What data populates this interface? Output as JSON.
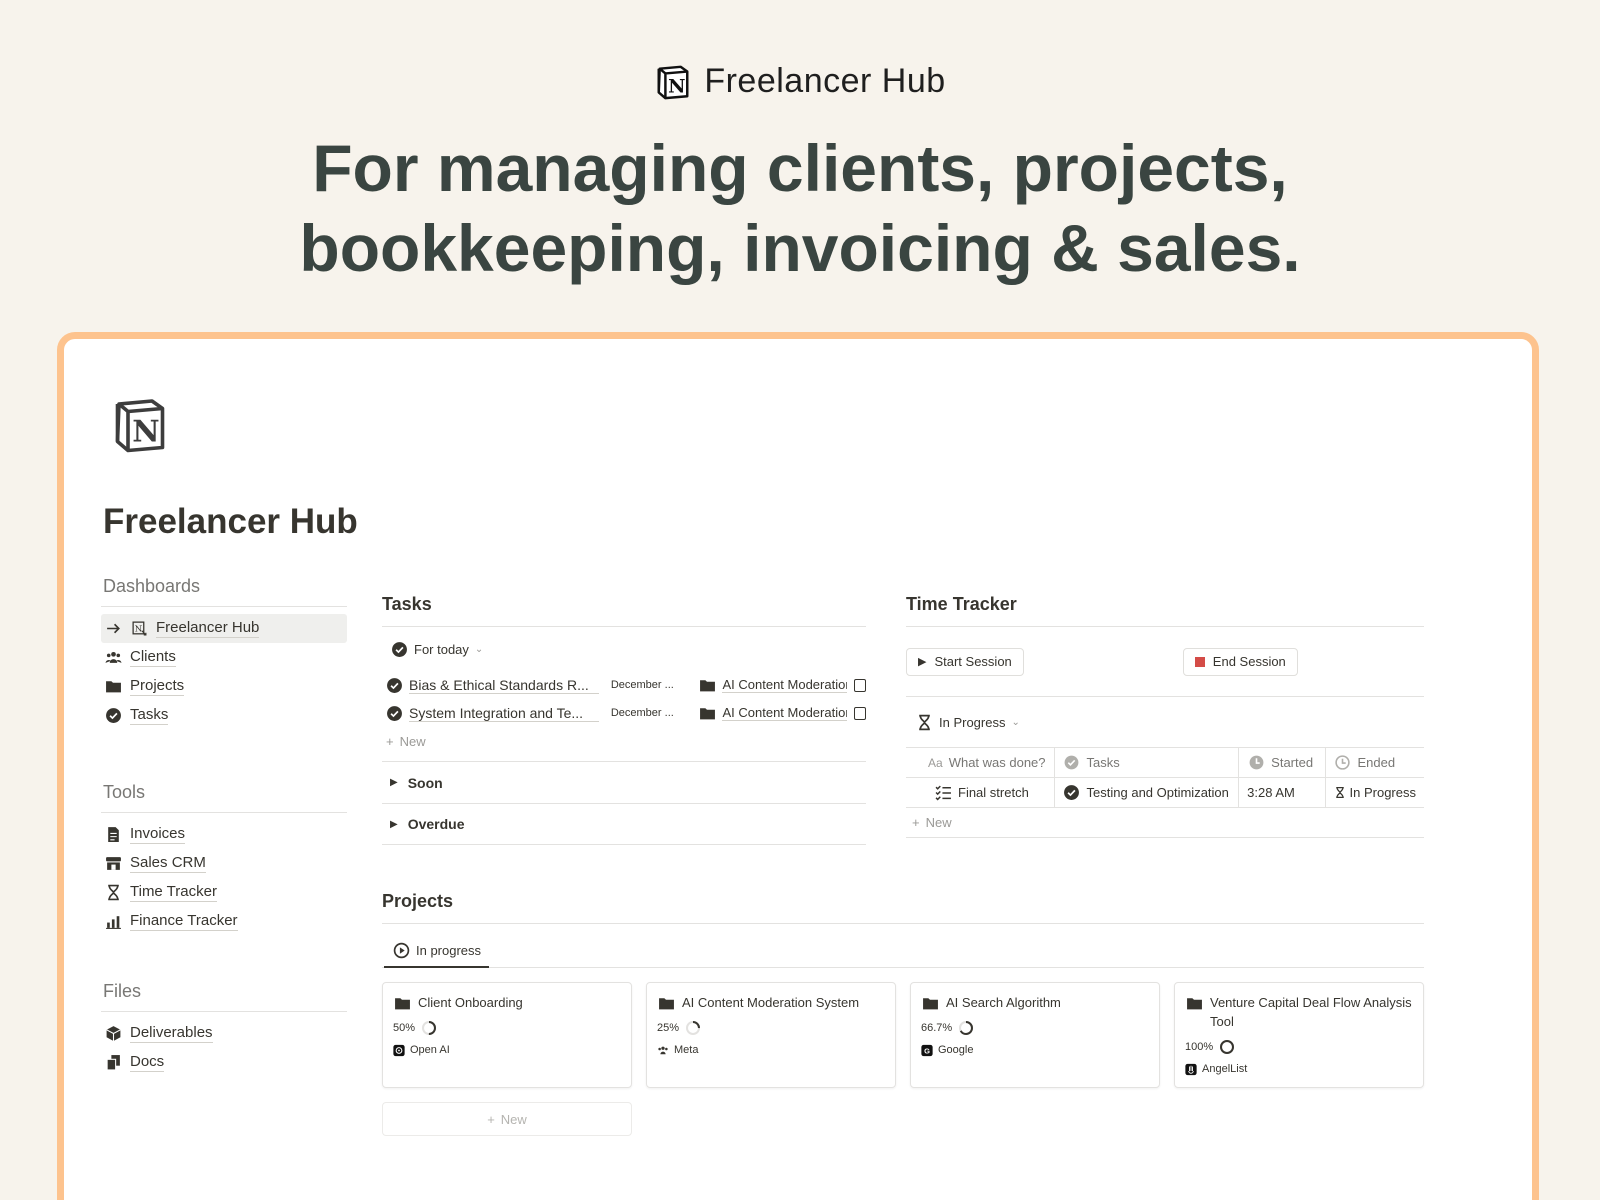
{
  "hero": {
    "brand_name": "Freelancer Hub",
    "headline_line1": "For managing clients, projects,",
    "headline_line2": "bookkeeping, invoicing & sales."
  },
  "page": {
    "title": "Freelancer Hub"
  },
  "sidebar": {
    "dashboards": {
      "heading": "Dashboards",
      "items": [
        {
          "label": "Freelancer Hub",
          "icon": "notion-link-icon",
          "active": true
        },
        {
          "label": "Clients",
          "icon": "people-icon"
        },
        {
          "label": "Projects",
          "icon": "folder-icon"
        },
        {
          "label": "Tasks",
          "icon": "check-circle-icon"
        }
      ]
    },
    "tools": {
      "heading": "Tools",
      "items": [
        {
          "label": "Invoices",
          "icon": "invoice-icon"
        },
        {
          "label": "Sales CRM",
          "icon": "store-icon"
        },
        {
          "label": "Time Tracker",
          "icon": "hourglass-icon"
        },
        {
          "label": "Finance Tracker",
          "icon": "chart-icon"
        }
      ]
    },
    "files": {
      "heading": "Files",
      "items": [
        {
          "label": "Deliverables",
          "icon": "box-icon"
        },
        {
          "label": "Docs",
          "icon": "documents-icon"
        }
      ]
    }
  },
  "tasks": {
    "title": "Tasks",
    "view": "For today",
    "rows": [
      {
        "name": "Bias & Ethical Standards R...",
        "date": "December ...",
        "project": "AI Content Moderatior"
      },
      {
        "name": "System Integration and Te...",
        "date": "December ...",
        "project": "AI Content Moderatior"
      }
    ],
    "new_label": "New",
    "groups": [
      "Soon",
      "Overdue"
    ]
  },
  "time_tracker": {
    "title": "Time Tracker",
    "start_label": "Start Session",
    "end_label": "End Session",
    "view": "In Progress",
    "columns": [
      "What was done?",
      "Tasks",
      "Started",
      "Ended"
    ],
    "column_prefix": "Aa",
    "row": {
      "what": "Final stretch",
      "task": "Testing and Optimization",
      "started": "3:28 AM",
      "ended": "In Progress"
    },
    "new_label": "New",
    "colors": {
      "end_square": "#d44c47"
    }
  },
  "projects": {
    "title": "Projects",
    "tab": "In progress",
    "cards": [
      {
        "name": "Client Onboarding",
        "progress_label": "50%",
        "progress": 0.5,
        "client": "Open AI",
        "client_icon": "openai-icon"
      },
      {
        "name": "AI Content Moderation System",
        "progress_label": "25%",
        "progress": 0.25,
        "client": "Meta",
        "client_icon": "people-icon"
      },
      {
        "name": "AI Search Algorithm",
        "progress_label": "66.7%",
        "progress": 0.667,
        "client": "Google",
        "client_icon": "google-icon"
      },
      {
        "name": "Venture Capital Deal Flow Analysis Tool",
        "progress_label": "100%",
        "progress": 1.0,
        "client": "AngelList",
        "client_icon": "angellist-icon"
      }
    ],
    "new_label": "New"
  },
  "colors": {
    "frame_border": "#fdc38e",
    "background": "#f7f3ec",
    "headline": "#3a4541"
  }
}
